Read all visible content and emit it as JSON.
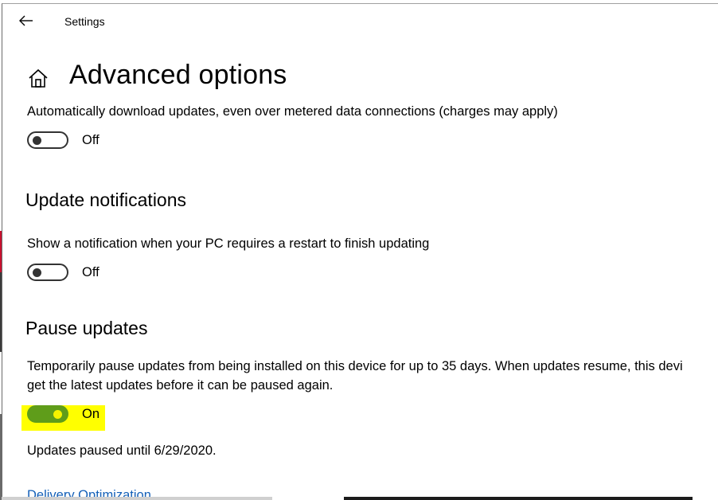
{
  "window": {
    "title": "Settings",
    "back_icon": "arrow-left-icon",
    "home_icon": "home-icon"
  },
  "page": {
    "title": "Advanced options"
  },
  "metered": {
    "description": "Automatically download updates, even over metered data connections (charges may apply)",
    "toggle_state": "Off"
  },
  "notifications": {
    "heading": "Update notifications",
    "description": "Show a notification when your PC requires a restart to finish updating",
    "toggle_state": "Off"
  },
  "pause": {
    "heading": "Pause updates",
    "description_line1": "Temporarily pause updates from being installed on this device for up to 35 days. When updates resume, this devi",
    "description_line2": "get the latest updates before it can be paused again.",
    "toggle_state": "On",
    "status": "Updates paused until 6/29/2020."
  },
  "links": {
    "delivery_optimization": "Delivery Optimization"
  },
  "colors": {
    "accent_toggle_on": "#5f9d1a",
    "highlight": "#ffff00",
    "link": "#1460b8"
  }
}
